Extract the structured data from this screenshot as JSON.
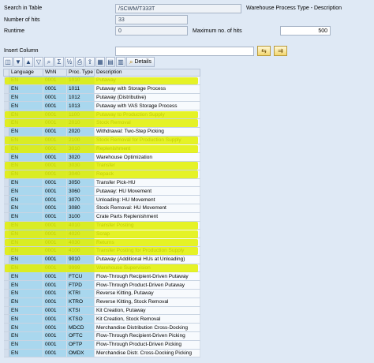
{
  "header": {
    "search_label": "Search in Table",
    "search_value": "/SCWM/T333T",
    "table_desc": "Warehouse Process Type - Description",
    "hits_label": "Number of hits",
    "hits_value": "33",
    "runtime_label": "Runtime",
    "runtime_value": "0",
    "maxhits_label": "Maximum no. of hits",
    "maxhits_value": "500"
  },
  "insert_column_label": "Insert Column",
  "insert_column_value": "",
  "toolbar": {
    "buttons": [
      "details-icon",
      "filter-icon",
      "sort-asc-icon",
      "sort-desc-icon",
      "find-icon",
      "sum-icon",
      "subtotal-icon",
      "print-icon",
      "export-icon",
      "layout-icon",
      "grid-icon",
      "chart-icon"
    ],
    "details_label": "Details"
  },
  "table": {
    "headers": [
      "Language",
      "WhN",
      "Proc. Type",
      "Description"
    ],
    "rows": [
      [
        "EN",
        "0001",
        "1010",
        "Putaway"
      ],
      [
        "EN",
        "0001",
        "1011",
        "Putaway with Storage Process"
      ],
      [
        "EN",
        "0001",
        "1012",
        "Putaway (Distributive)"
      ],
      [
        "EN",
        "0001",
        "1013",
        "Putaway with VAS Storage Process"
      ],
      [
        "EN",
        "0001",
        "1100",
        "Putaway to Production Supply"
      ],
      [
        "EN",
        "0001",
        "2010",
        "Stock Removal"
      ],
      [
        "EN",
        "0001",
        "2020",
        "Withdrawal: Two-Step Picking"
      ],
      [
        "EN",
        "0001",
        "2100",
        "Stock Removal for Production Supply"
      ],
      [
        "EN",
        "0001",
        "3010",
        "Replenishment"
      ],
      [
        "EN",
        "0001",
        "3020",
        "Warehouse Optimization"
      ],
      [
        "EN",
        "0001",
        "3030",
        "Transfer"
      ],
      [
        "EN",
        "0001",
        "3040",
        "Repack"
      ],
      [
        "EN",
        "0001",
        "3050",
        "Transfer Pick-HU"
      ],
      [
        "EN",
        "0001",
        "3060",
        "Putaway: HU Movement"
      ],
      [
        "EN",
        "0001",
        "3070",
        "Unloading: HU Movement"
      ],
      [
        "EN",
        "0001",
        "3080",
        "Stock Removal: HU Movement"
      ],
      [
        "EN",
        "0001",
        "3100",
        "Crate Parts Replenishment"
      ],
      [
        "EN",
        "0001",
        "4010",
        "Transfer Posting"
      ],
      [
        "EN",
        "0001",
        "4020",
        "Scrap"
      ],
      [
        "EN",
        "0001",
        "4030",
        "Returns"
      ],
      [
        "EN",
        "0001",
        "4100",
        "Transfer Posting for Production Supply"
      ],
      [
        "EN",
        "0001",
        "9010",
        "Putaway (Additional HUs at Unloading)"
      ],
      [
        "EN",
        "0001",
        "9999",
        "Warehouse Supervision"
      ],
      [
        "EN",
        "0001",
        "FTCU",
        "Flow-Through Recipient-Driven Putaway"
      ],
      [
        "EN",
        "0001",
        "FTPD",
        "Flow-Through Product-Driven Putaway"
      ],
      [
        "EN",
        "0001",
        "KTRI",
        "Reverse Kitting, Putaway"
      ],
      [
        "EN",
        "0001",
        "KTRO",
        "Reverse Kitting, Stock Removal"
      ],
      [
        "EN",
        "0001",
        "KTSI",
        "Kit Creation, Putaway"
      ],
      [
        "EN",
        "0001",
        "KTSO",
        "Kit Creation, Stock Removal"
      ],
      [
        "EN",
        "0001",
        "MDCD",
        "Merchandise Distribution Cross-Docking"
      ],
      [
        "EN",
        "0001",
        "OFTC",
        "Flow-Through Recipient-Driven Picking"
      ],
      [
        "EN",
        "0001",
        "OFTP",
        "Flow-Through Product-Driven Picking"
      ],
      [
        "EN",
        "0001",
        "OMDX",
        "Merchandise Distr. Cross-Docking Picking"
      ]
    ],
    "highlighted_rows": [
      0,
      4,
      5,
      7,
      8,
      10,
      11,
      17,
      18,
      19,
      20,
      22
    ]
  },
  "colors": {
    "highlight": "#e2f000",
    "key_column": "#a9d7ee",
    "background": "#dfe9f5"
  }
}
